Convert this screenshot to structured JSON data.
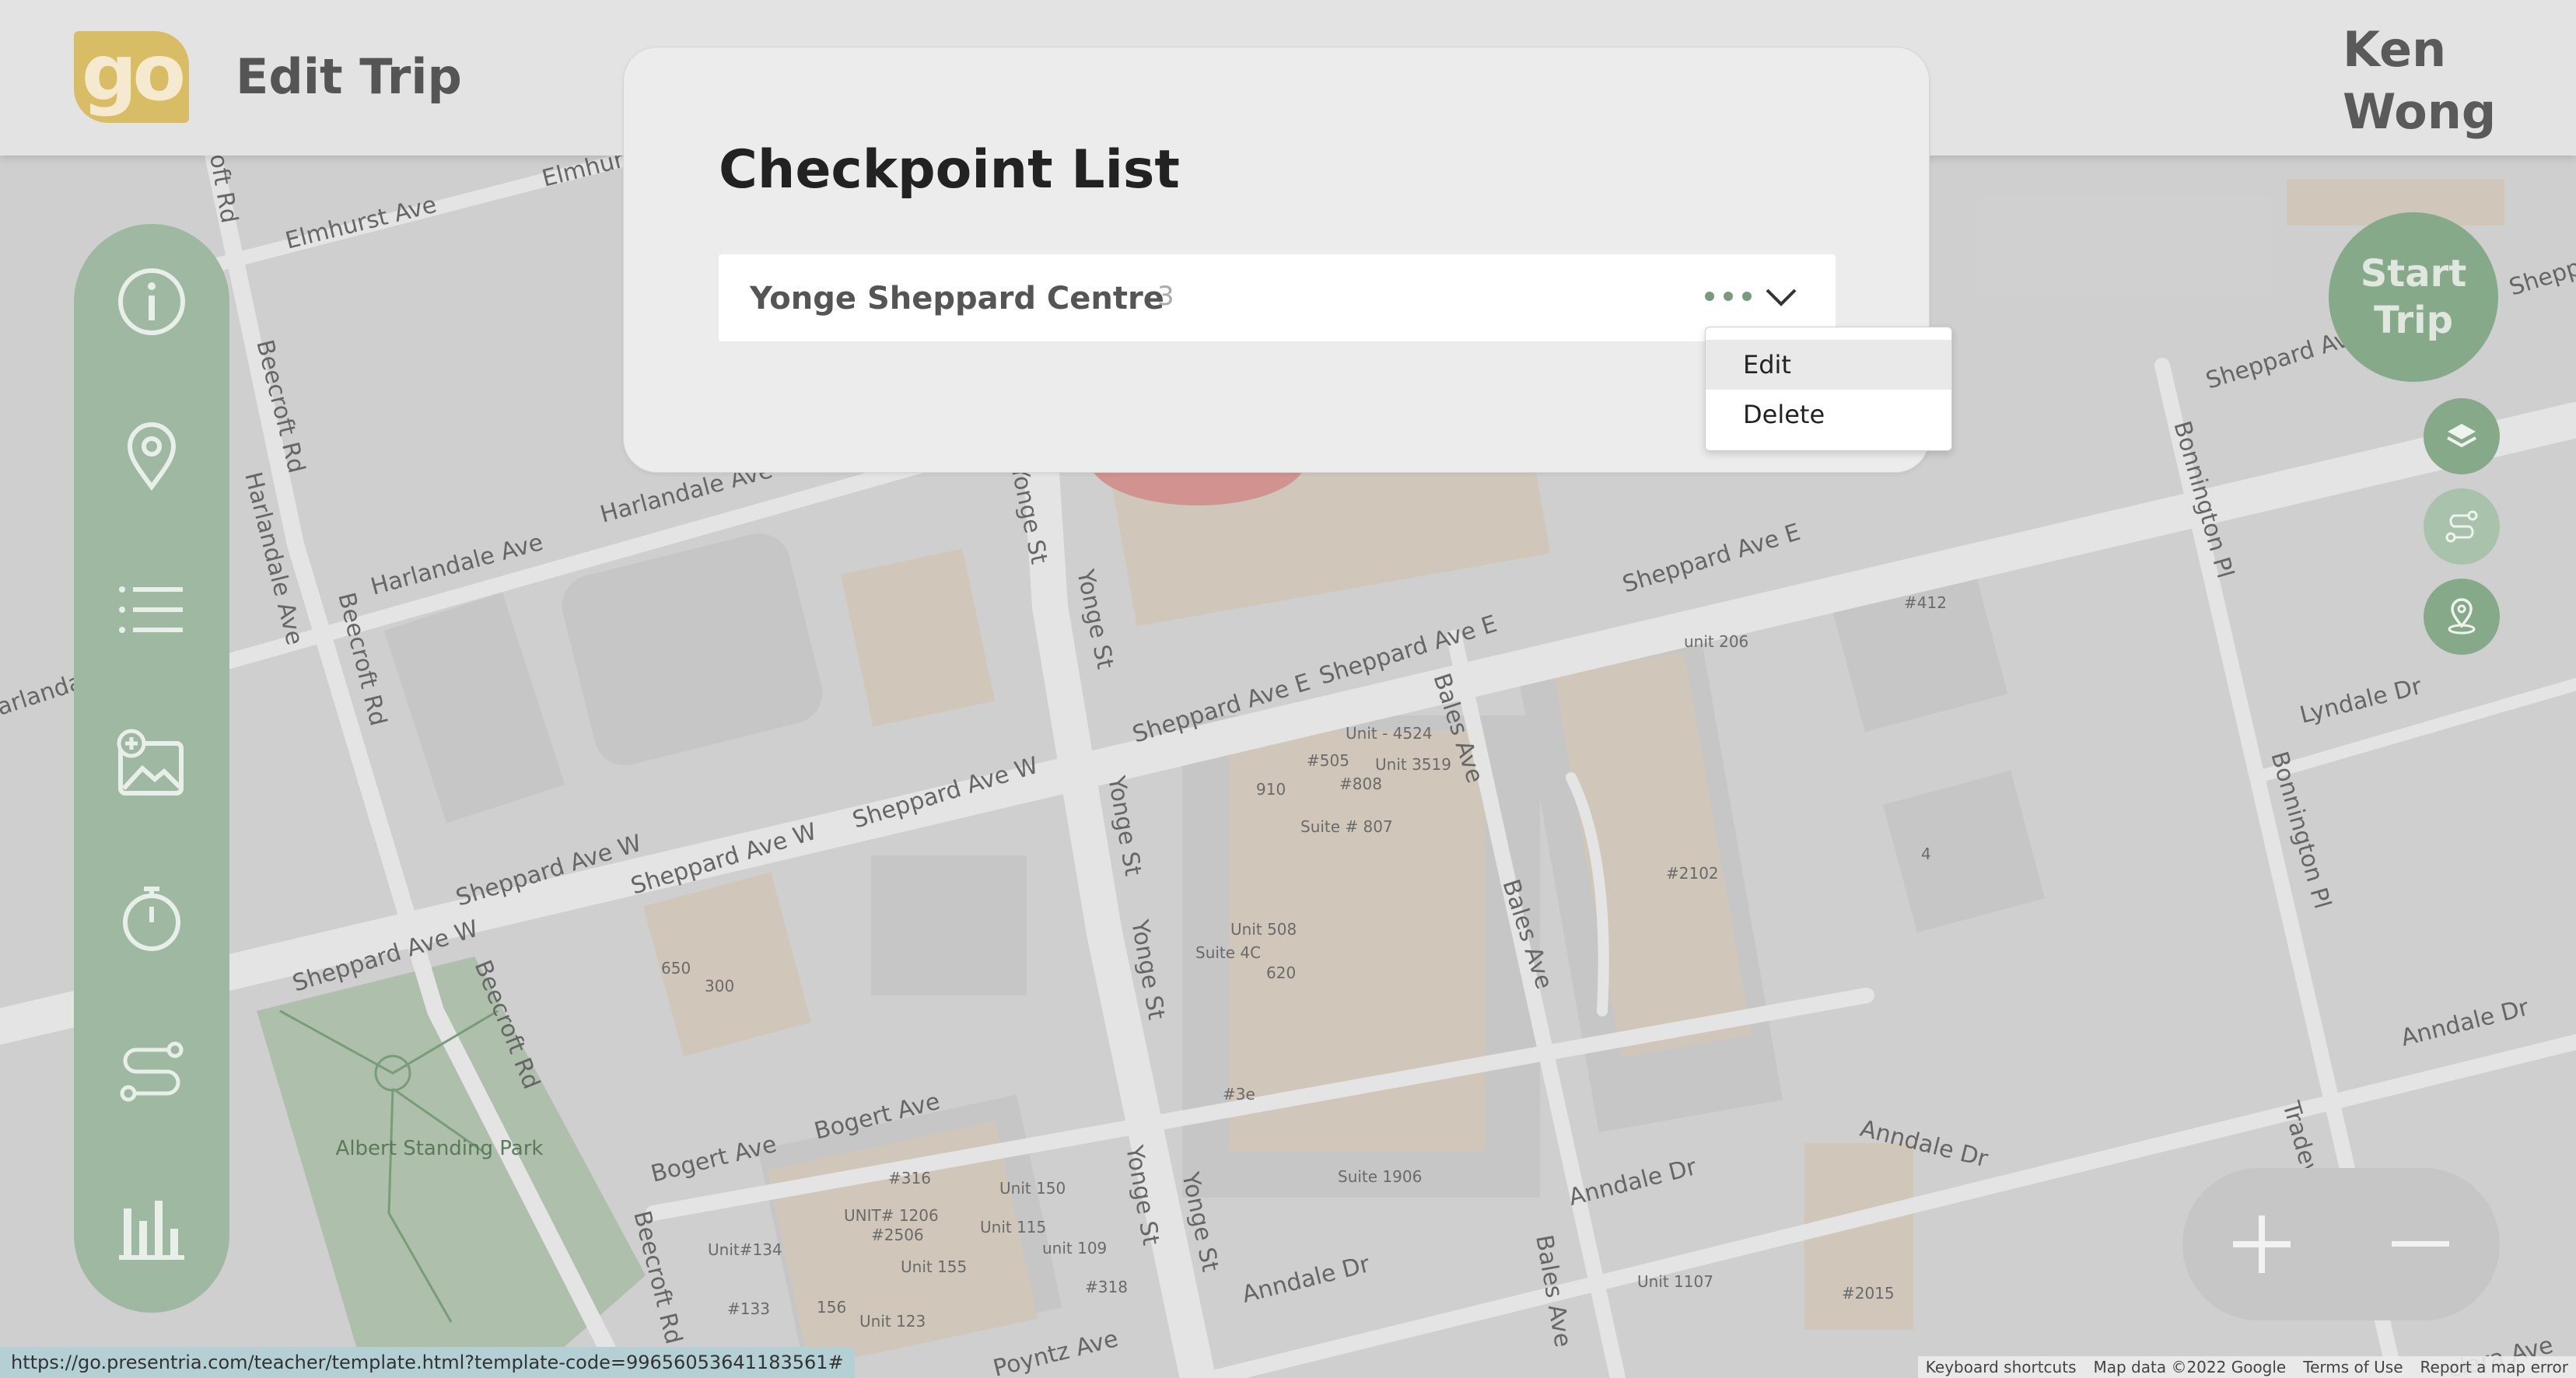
{
  "header": {
    "logo_text": "go",
    "title": "Edit Trip",
    "user_name": "Ken Wong"
  },
  "sidebar": {
    "items": [
      {
        "icon": "info-icon"
      },
      {
        "icon": "location-pin-icon"
      },
      {
        "icon": "list-icon"
      },
      {
        "icon": "add-image-icon"
      },
      {
        "icon": "timer-icon"
      },
      {
        "icon": "route-icon"
      },
      {
        "icon": "bar-chart-icon"
      }
    ]
  },
  "right_controls": {
    "start_trip_label": "Start Trip",
    "layers_icon": "layers-icon",
    "route_icon": "route-icon",
    "pin_icon": "pin-icon"
  },
  "zoom": {
    "plus": "+",
    "minus": "−"
  },
  "modal": {
    "title": "Checkpoint List",
    "checkpoints": [
      {
        "name": "Yonge Sheppard Centre",
        "count": "3"
      }
    ],
    "menu": {
      "edit": "Edit",
      "delete": "Delete"
    }
  },
  "map": {
    "streets": {
      "elmhurst_ave": "Elmhurst Ave",
      "beecroft_rd": "Beecroft Rd",
      "harlandale_ave": "Harlandale Ave",
      "sheppard_ave_w": "Sheppard Ave W",
      "sheppard_ave_e": "Sheppard Ave E",
      "yonge_st": "Yonge St",
      "bales_ave": "Bales Ave",
      "bogert_ave": "Bogert Ave",
      "anndale_dr": "Anndale Dr",
      "poyntz_ave": "Poyntz Ave",
      "bonnington_pl": "Bonnington Pl",
      "lyndale_dr": "Lyndale Dr",
      "tradewind_ave": "Tradewind Ave",
      "oft_rd": "oft Rd",
      "arlandale": "arlandale",
      "clara_ave": "clara Ave",
      "sheppa": "Shepp"
    },
    "park": "Albert Standing Park",
    "pois": {
      "unit_4524": "Unit - 4524",
      "p505": "#505",
      "unit_3519": "Unit 3519",
      "p910": "910",
      "p808": "#808",
      "suite_807": "Suite # 807",
      "unit_508": "Unit 508",
      "suite_4c": "Suite 4C",
      "p620": "620",
      "p3e": "#3e",
      "suite_1906": "Suite 1906",
      "p650": "650",
      "p300": "300",
      "p316": "#316",
      "unit_1206": "UNIT# 1206",
      "p2506": "#2506",
      "unit_150": "Unit 150",
      "unit_115": "Unit 115",
      "unit_134": "Unit#134",
      "unit_155": "Unit 155",
      "unit_109": "unit 109",
      "p318": "#318",
      "p133": "#133",
      "p156": "156",
      "unit_123": "Unit 123",
      "unit_206": "unit 206",
      "p412": "#412",
      "p2102": "#2102",
      "p4": "4",
      "unit_1107": "Unit 1107",
      "p2015": "#2015"
    }
  },
  "status_url": "https://go.presentria.com/teacher/template.html?template-code=99656053641183561#",
  "map_footer": {
    "shortcuts": "Keyboard shortcuts",
    "data": "Map data ©2022 Google",
    "terms": "Terms of Use",
    "report": "Report a map error"
  }
}
